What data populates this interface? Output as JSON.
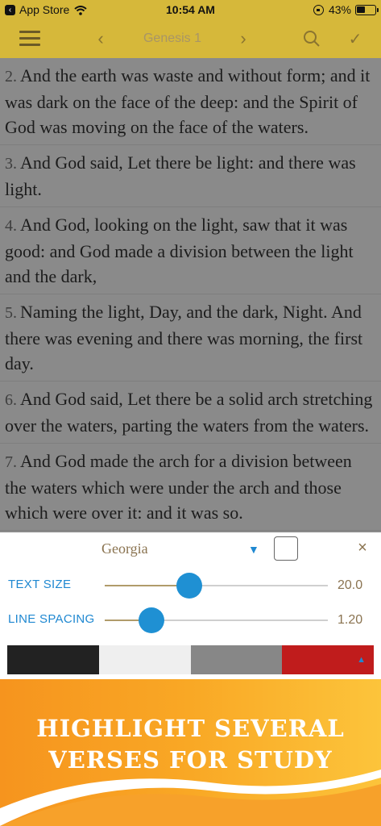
{
  "status_bar": {
    "back_app": "App Store",
    "time": "10:54 AM",
    "battery": "43%"
  },
  "toolbar": {
    "title": "Genesis 1",
    "prev": "‹",
    "next": "›",
    "check": "✓"
  },
  "verses": [
    {
      "num": "2.",
      "text": "And the earth was waste and without form; and it was dark on the face of the deep: and the Spirit of God was moving on the face of the waters."
    },
    {
      "num": "3.",
      "text": "And God said, Let there be light: and there was light."
    },
    {
      "num": "4.",
      "text": "And God, looking on the light, saw that it was good: and God made a division between the light and the dark,"
    },
    {
      "num": "5.",
      "text": "Naming the light, Day, and the dark, Night. And there was evening and there was morning, the first day."
    },
    {
      "num": "6.",
      "text": "And God said, Let there be a solid arch stretching over the waters, parting the waters from the waters."
    },
    {
      "num": "7.",
      "text": "And God made the arch for a division between the waters which were under the arch and those which were over it: and it was so."
    }
  ],
  "settings": {
    "font_name": "Georgia",
    "close": "×",
    "text_size_label": "TEXT SIZE",
    "text_size_value": "20.0",
    "text_size_fraction": 0.38,
    "line_spacing_label": "LINE SPACING",
    "line_spacing_value": "1.20",
    "line_spacing_fraction": 0.21,
    "swatches": [
      "#222222",
      "#efefef",
      "#878787",
      "#c01c1c"
    ],
    "accent": "#1f88d1"
  },
  "banner": {
    "line1": "HIGHLIGHT SEVERAL",
    "line2": "VERSES FOR STUDY"
  }
}
